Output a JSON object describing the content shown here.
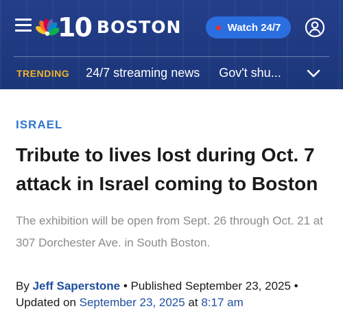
{
  "header": {
    "logo_number": "10",
    "logo_city": "BOSTON",
    "watch_label": "Watch 24/7",
    "accent_color": "#2b6ee0",
    "live_dot_color": "#e53030",
    "background_color": "#1d3c84"
  },
  "trending": {
    "label": "TRENDING",
    "items": [
      "24/7 streaming news",
      "Gov't shu..."
    ]
  },
  "article": {
    "category": "ISRAEL",
    "headline": "Tribute to lives lost during Oct. 7 attack in Israel coming to Boston",
    "dek": "The exhibition will be open from Sept. 26 through Oct. 21 at 307 Dorchester Ave. in South Boston.",
    "byline": {
      "by_prefix": "By ",
      "author": "Jeff Saperstone",
      "published_prefix": " • Published September 23, 2025 •",
      "updated_prefix": "Updated on ",
      "updated_date": "September 23, 2025",
      "at_word": " at ",
      "updated_time": "8:17 am"
    }
  }
}
